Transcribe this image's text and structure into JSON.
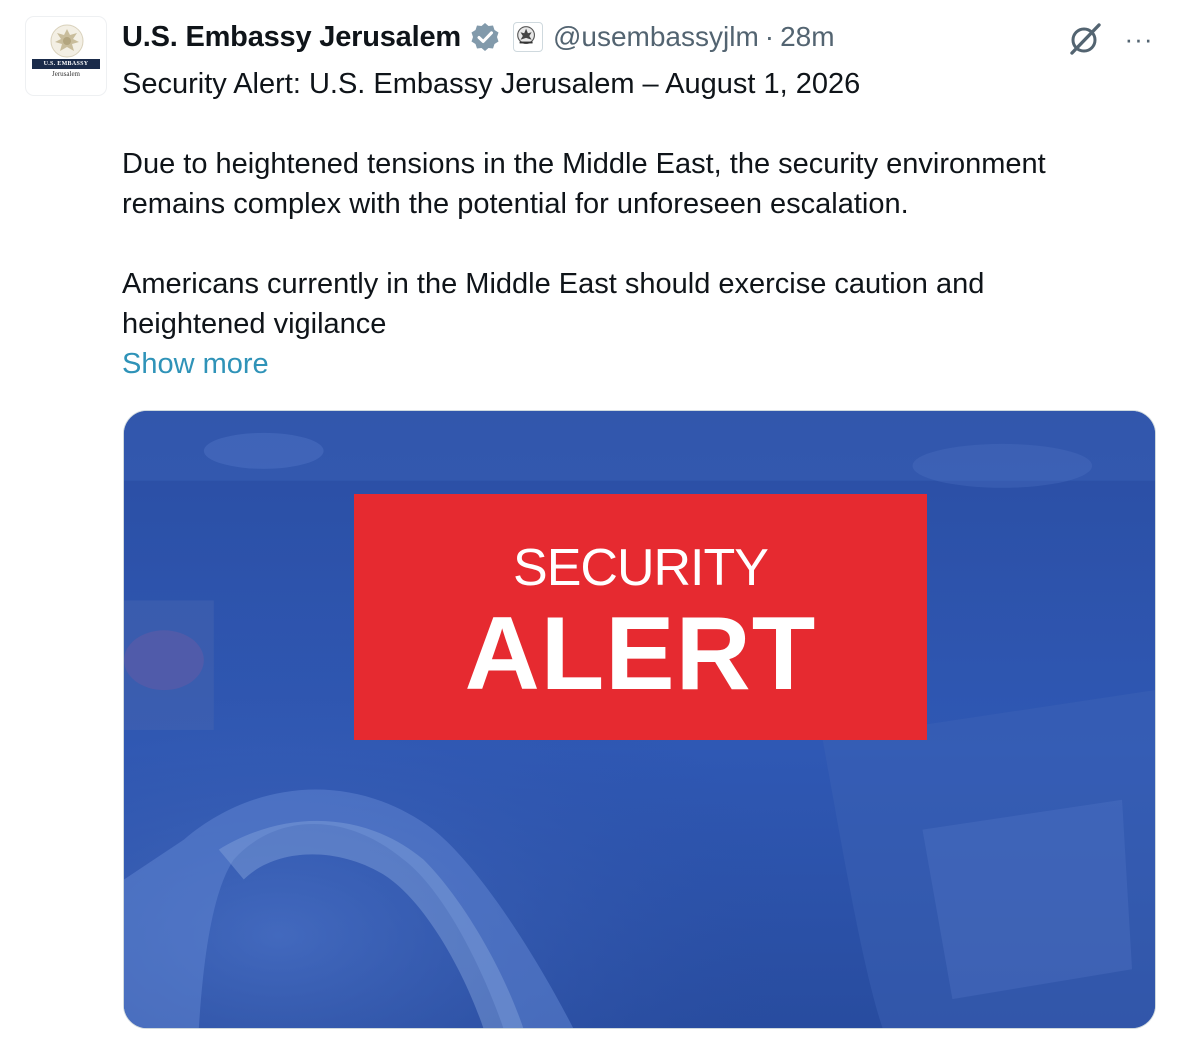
{
  "author": {
    "display_name": "U.S. Embassy Jerusalem",
    "handle": "@usembassyjlm",
    "separator": "·",
    "timestamp": "28m",
    "verified_icon": "verified-badge-icon",
    "affiliation_icon": "government-seal-icon",
    "avatar": {
      "line1": "U.S. EMBASSY",
      "line2": "Jerusalem"
    }
  },
  "actions": {
    "grok_icon": "grok-icon",
    "more_icon": "more-options-icon",
    "more_label": "···"
  },
  "post": {
    "title": "Security Alert: U.S. Embassy Jerusalem – August 1, 2026",
    "para1_line1": "Due to heightened tensions in the Middle East, the security environment",
    "para1_line2": "remains complex with the potential for unforeseen escalation.",
    "para2_line1": "Americans currently in the Middle East should exercise caution and",
    "para2_line2": "heightened vigilance",
    "show_more": "Show more"
  },
  "media": {
    "alert_line1": "SECURITY",
    "alert_line2": "ALERT",
    "alert_color": "#e62a30",
    "background_color": "#2a4fa6"
  },
  "colors": {
    "text": "#0f1419",
    "secondary": "#536471",
    "link": "#2f93b8",
    "verified": "#829aab"
  }
}
